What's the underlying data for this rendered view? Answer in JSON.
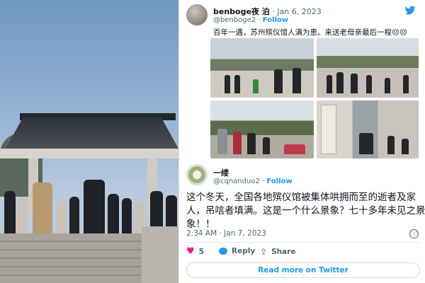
{
  "tweet": {
    "author_name": "benboge夜 泊",
    "date_sep": " · ",
    "date": "Jan 6, 2023",
    "handle": "@benboge2",
    "follow_sep": " · ",
    "follow_label": "Follow",
    "text": "百年一遇，苏州殡仪馆人满为患。来送老母亲最后一程😔😔",
    "brand_color": "#1d9bf0"
  },
  "quoted": {
    "author_name": "一缕",
    "handle": "@cqnanduo2",
    "follow_sep": " · ",
    "follow_label": "Follow",
    "text_lines": [
      "这个冬天，全国各地殡仪馆被集体哄拥而至的逝者及家",
      "人，吊唁者填满。这是一个什么景象？七十多年未见之景",
      "象！！"
    ],
    "time": "2:34 AM · Jan 7, 2023",
    "info_icon": "ⓘ",
    "likes_count": "5",
    "reply_label": "Reply",
    "share_label": "Share",
    "read_more_label": "Read more on Twitter",
    "heart_color": "#f91880"
  },
  "icons": {
    "bird": "twitter-bird-icon",
    "heart": "heart-icon",
    "reply": "reply-bubble-icon",
    "share": "share-arrow-icon",
    "info": "info-icon"
  }
}
